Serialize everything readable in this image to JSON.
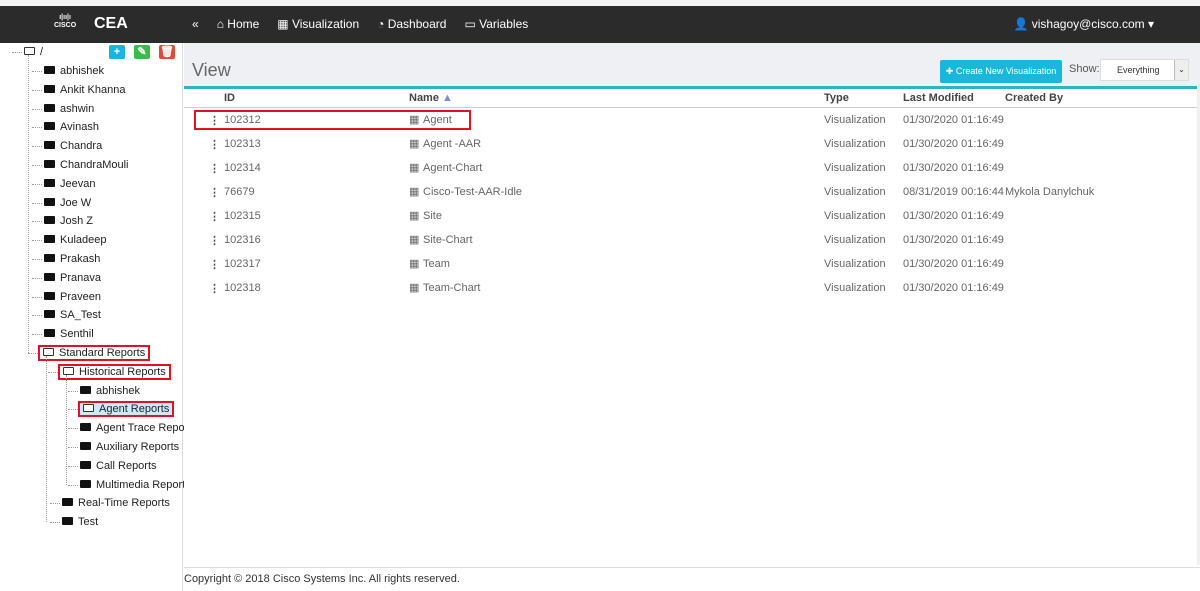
{
  "nav": {
    "brand": "CEA",
    "logo_text": "cisco",
    "collapse": "«",
    "items": [
      "Home",
      "Visualization",
      "Dashboard",
      "Variables"
    ],
    "user": "vishagoy@cisco.com"
  },
  "tree": {
    "root": "/",
    "folders": [
      "abhishek",
      "Ankit Khanna",
      "ashwin",
      "Avinash",
      "Chandra",
      "ChandraMouli",
      "Jeevan",
      "Joe W",
      "Josh Z",
      "Kuladeep",
      "Prakash",
      "Pranava",
      "Praveen",
      "SA_Test",
      "Senthil"
    ],
    "standard": "Standard Reports",
    "historical": "Historical Reports",
    "historical_children": [
      "abhishek",
      "Agent Reports",
      "Agent Trace Repor",
      "Auxiliary Reports",
      "Call Reports",
      "Multimedia Report"
    ],
    "standard_children": [
      "Real-Time Reports",
      "Test"
    ]
  },
  "main": {
    "title": "View",
    "create_label": "Create New Visualization",
    "show_label": "Show:",
    "show_value": "Everything",
    "columns": [
      "ID",
      "Name",
      "Type",
      "Last Modified",
      "Created By"
    ],
    "rows": [
      {
        "id": "102312",
        "name": "Agent",
        "type": "Visualization",
        "modified": "01/30/2020 01:16:49",
        "by": ""
      },
      {
        "id": "102313",
        "name": "Agent -AAR",
        "type": "Visualization",
        "modified": "01/30/2020 01:16:49",
        "by": ""
      },
      {
        "id": "102314",
        "name": "Agent-Chart",
        "type": "Visualization",
        "modified": "01/30/2020 01:16:49",
        "by": ""
      },
      {
        "id": "76679",
        "name": "Cisco-Test-AAR-Idle",
        "type": "Visualization",
        "modified": "08/31/2019 00:16:44",
        "by": "Mykola Danylchuk"
      },
      {
        "id": "102315",
        "name": "Site",
        "type": "Visualization",
        "modified": "01/30/2020 01:16:49",
        "by": ""
      },
      {
        "id": "102316",
        "name": "Site-Chart",
        "type": "Visualization",
        "modified": "01/30/2020 01:16:49",
        "by": ""
      },
      {
        "id": "102317",
        "name": "Team",
        "type": "Visualization",
        "modified": "01/30/2020 01:16:49",
        "by": ""
      },
      {
        "id": "102318",
        "name": "Team-Chart",
        "type": "Visualization",
        "modified": "01/30/2020 01:16:49",
        "by": ""
      }
    ]
  },
  "footer": "Copyright © 2018 Cisco Systems Inc. All rights reserved."
}
